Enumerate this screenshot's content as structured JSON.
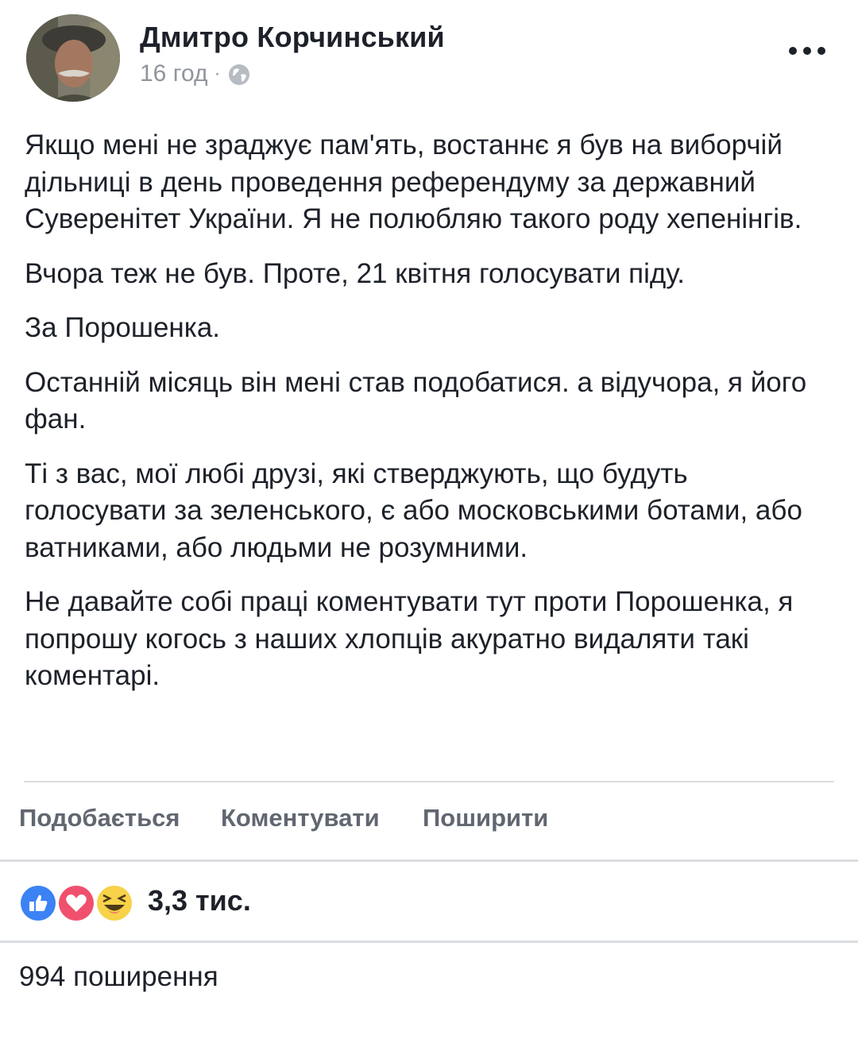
{
  "post": {
    "author": "Дмитро Корчинський",
    "time": "16 год",
    "separator": "·",
    "privacy_icon": "globe-icon",
    "more_icon": "more-dots-icon",
    "paragraphs": [
      "Якщо мені не зраджує пам'ять, востаннє я був на виборчій дільниці в день проведення референдуму за державний Суверенітет України. Я не полюбляю такого роду хепенінгів.",
      "Вчора теж не був. Проте, 21 квітня голосувати піду.",
      "За Порошенка.",
      "Останній місяць він мені став подобатися. а відучора, я його фан.",
      "Ті з вас, мої любі друзі, які стверджують, що будуть голосувати за зеленського, є або московськими ботами, або ватниками, або людьми не розумними.",
      "Не давайте собі праці коментувати тут проти Порошенка, я попрошу когось з наших хлопців акуратно видаляти такі коментарі."
    ]
  },
  "actions": {
    "like_label": "Подобається",
    "comment_label": "Коментувати",
    "share_label": "Поширити"
  },
  "reactions": {
    "icons": [
      "like-icon",
      "love-icon",
      "haha-icon"
    ],
    "count": "3,3 тис."
  },
  "shares": {
    "label": "994 поширення"
  },
  "colors": {
    "text": "#1d2129",
    "secondary": "#90949c",
    "action": "#616770",
    "divider": "#dadde1",
    "like_blue": "#3b82f5",
    "love_red": "#f0506e",
    "haha_yellow": "#f7d24a"
  }
}
